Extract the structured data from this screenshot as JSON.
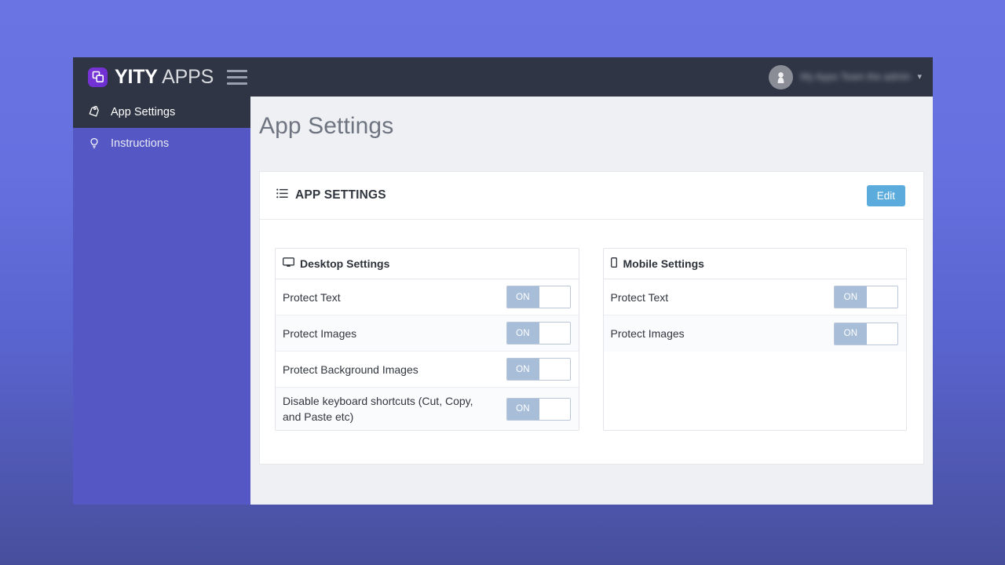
{
  "brand": {
    "name_bold": "YITY",
    "name_light": "APPS",
    "logo_icon": "overlapping-squares-icon",
    "menu_icon": "hamburger-icon"
  },
  "navbar": {
    "user_name": "My Apps Team the admin",
    "avatar_icon": "user-avatar-icon",
    "caret_icon": "chevron-down-icon"
  },
  "sidebar": {
    "items": [
      {
        "label": "App Settings",
        "icon": "tag-icon",
        "active": true
      },
      {
        "label": "Instructions",
        "icon": "lightbulb-icon",
        "active": false
      }
    ]
  },
  "page": {
    "title": "App Settings"
  },
  "card": {
    "title": "APP SETTINGS",
    "title_icon": "list-icon",
    "edit_label": "Edit"
  },
  "panels": [
    {
      "title": "Desktop Settings",
      "icon": "desktop-icon",
      "rows": [
        {
          "label": "Protect Text",
          "state": "ON"
        },
        {
          "label": "Protect Images",
          "state": "ON"
        },
        {
          "label": "Protect Background Images",
          "state": "ON"
        },
        {
          "label": "Disable keyboard shortcuts (Cut, Copy, and Paste etc)",
          "state": "ON"
        }
      ]
    },
    {
      "title": "Mobile Settings",
      "icon": "mobile-icon",
      "rows": [
        {
          "label": "Protect Text",
          "state": "ON"
        },
        {
          "label": "Protect Images",
          "state": "ON"
        }
      ]
    }
  ],
  "colors": {
    "page_background": "#6670df",
    "navbar": "#2f3545",
    "sidebar": "#5457c4",
    "sidebar_active": "#2f3545",
    "content_background": "#eff0f3",
    "edit_button": "#5bacdd",
    "toggle_on": "#a7bdd8",
    "logo": "#6b2fd0"
  }
}
